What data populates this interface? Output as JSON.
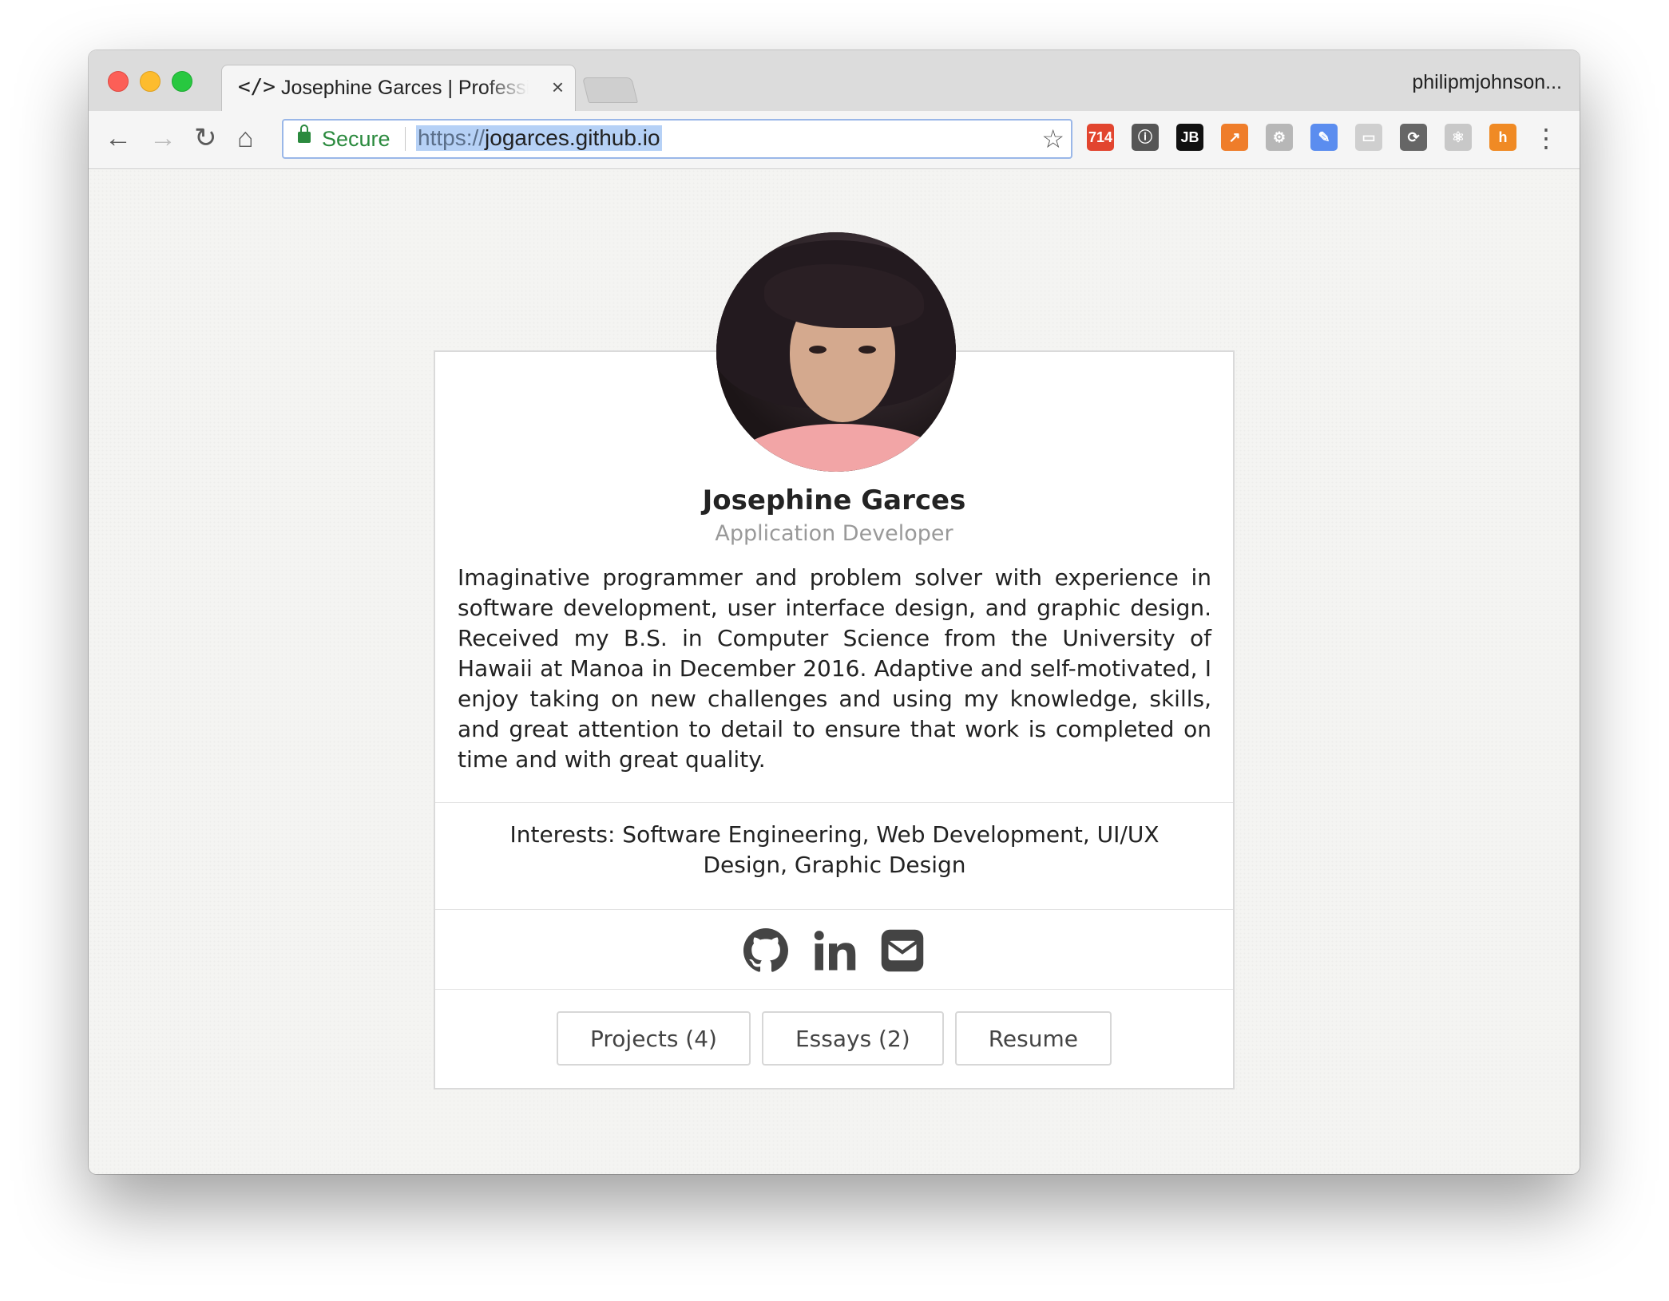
{
  "browser": {
    "tab": {
      "icon": "code-icon",
      "icon_glyph": "</>",
      "title": "Josephine Garces | Professional",
      "close": "×"
    },
    "profile_name": "philipmjohnson...",
    "address_bar": {
      "secure_label": "Secure",
      "scheme": "https://",
      "host": "jogarces.github.io"
    },
    "extensions": [
      {
        "name": "rss-extension-icon",
        "label": "714",
        "color": "#e2452f"
      },
      {
        "name": "info-extension-icon",
        "label": "ⓘ",
        "color": "#555555"
      },
      {
        "name": "jetbrains-extension-icon",
        "label": "JB",
        "color": "#111111"
      },
      {
        "name": "chart-extension-icon",
        "label": "↗",
        "color": "#ef7d2a"
      },
      {
        "name": "tool-extension-icon",
        "label": "⚙",
        "color": "#b7b7b7"
      },
      {
        "name": "eyedropper-extension-icon",
        "label": "✎",
        "color": "#5b8def"
      },
      {
        "name": "page-extension-icon",
        "label": "▭",
        "color": "#cfcfcf"
      },
      {
        "name": "sync-extension-icon",
        "label": "⟳",
        "color": "#666666"
      },
      {
        "name": "react-extension-icon",
        "label": "⚛",
        "color": "#c8c8c8"
      },
      {
        "name": "honey-extension-icon",
        "label": "h",
        "color": "#f08a24"
      }
    ]
  },
  "profile": {
    "name": "Josephine Garces",
    "role": "Application Developer",
    "bio": "Imaginative programmer and problem solver with experience in software development, user interface design, and graphic design. Received my B.S. in Computer Science from the University of Hawaii at Manoa in December 2016. Adaptive and self-motivated, I enjoy taking on new challenges and using my knowledge, skills, and great attention to detail to ensure that work is completed on time and with great quality.",
    "interests": "Interests: Software Engineering, Web Development, UI/UX Design, Graphic Design",
    "social": [
      {
        "name": "github-icon"
      },
      {
        "name": "linkedin-icon"
      },
      {
        "name": "email-icon"
      }
    ],
    "buttons": {
      "projects": "Projects (4)",
      "essays": "Essays (2)",
      "resume": "Resume"
    }
  }
}
